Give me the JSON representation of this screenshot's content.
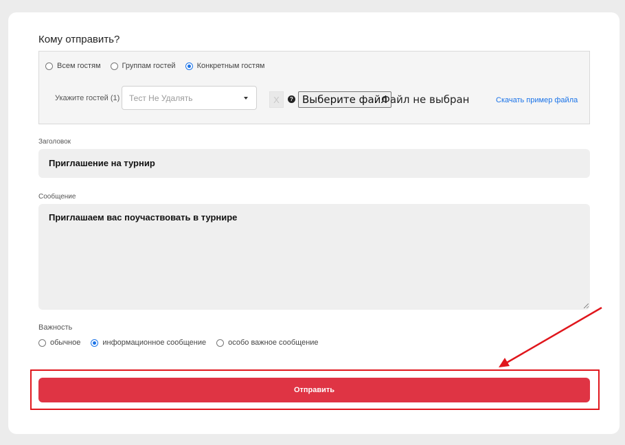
{
  "form": {
    "recipients_title": "Кому отправить?",
    "recipient_options": [
      {
        "label": "Всем гостям",
        "checked": false
      },
      {
        "label": "Группам гостей",
        "checked": false
      },
      {
        "label": "Конкретным гостям",
        "checked": true
      }
    ],
    "guests_label": "Укажите гостей (1)",
    "guest_select_value": "Тест Не Удалять",
    "clear_label": "X",
    "help_symbol": "?",
    "file_button_label": "Выберите файл",
    "file_status": "Файл не выбран",
    "sample_link": "Скачать пример файла",
    "title_label": "Заголовок",
    "title_value": "Приглашение на турнир",
    "message_label": "Сообщение",
    "message_value": "Приглашаем вас поучаствовать в турнире",
    "importance_label": "Важность",
    "importance_options": [
      {
        "label": "обычное",
        "checked": false
      },
      {
        "label": "информационное сообщение",
        "checked": true
      },
      {
        "label": "особо важное сообщение",
        "checked": false
      }
    ],
    "submit_label": "Отправить"
  },
  "colors": {
    "accent": "#1a73e8",
    "submit": "#df3444",
    "highlight": "#e0161c"
  }
}
